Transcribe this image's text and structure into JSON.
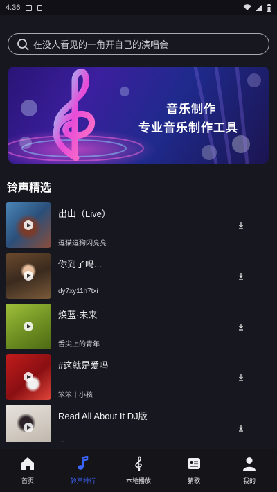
{
  "status_bar": {
    "time": "4:36"
  },
  "search": {
    "placeholder": "在没人看见的一角开自己的演唱会"
  },
  "banner": {
    "line1": "音乐制作",
    "line2": "专业音乐制作工具"
  },
  "section": {
    "title": "铃声精选"
  },
  "ringtones": [
    {
      "name": "出山（Live）",
      "artist": "逗猫逗狗闪亮亮"
    },
    {
      "name": "你到了吗...",
      "artist": "dy7xy11h7txi"
    },
    {
      "name": "焕蓝·未来",
      "artist": "舌尖上的青年"
    },
    {
      "name": "#这就是爱吗",
      "artist": "笨笨丨小孩"
    },
    {
      "name": "Read All About It   DJ版",
      "artist": "琪"
    }
  ],
  "tabs": [
    {
      "label": "首页",
      "icon": "home-icon"
    },
    {
      "label": "铃声排行",
      "icon": "music-note-icon",
      "active": true
    },
    {
      "label": "本地播放",
      "icon": "treble-clef-icon"
    },
    {
      "label": "猜歌",
      "icon": "quiz-card-icon"
    },
    {
      "label": "我的",
      "icon": "person-icon"
    }
  ],
  "colors": {
    "background": "#17171f",
    "accent": "#3d66ff",
    "tabbar": "#141419"
  }
}
